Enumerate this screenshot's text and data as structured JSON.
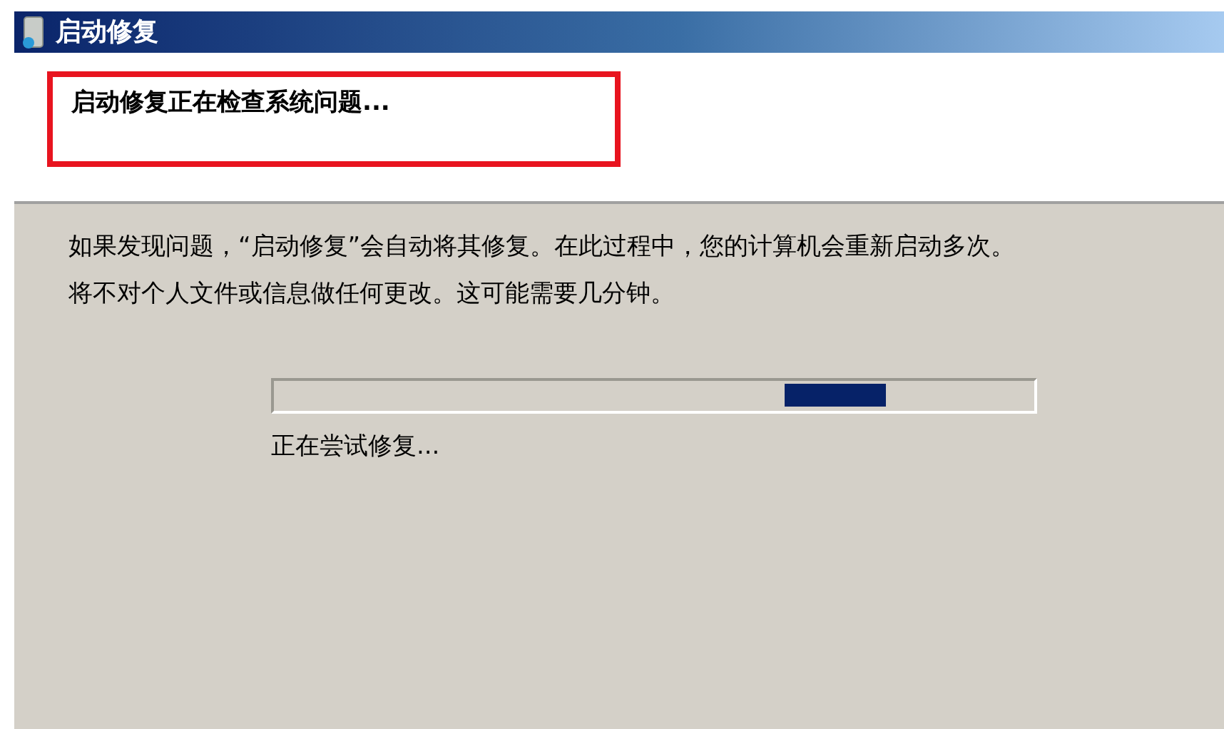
{
  "window": {
    "title": "启动修复"
  },
  "heading": {
    "text": "启动修复正在检查系统问题...",
    "highlighted": true
  },
  "paragraphs": [
    "如果发现问题，“启动修复”会自动将其修复。在此过程中，您的计算机会重新启动多次。",
    "将不对个人文件或信息做任何更改。这可能需要几分钟。"
  ],
  "progress": {
    "indeterminate": true
  },
  "status": "正在尝试修复..."
}
